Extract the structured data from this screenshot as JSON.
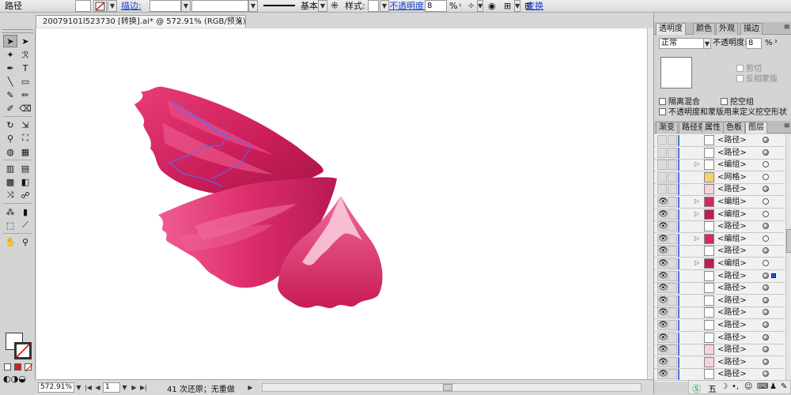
{
  "control_bar": {
    "object_type": "路径",
    "stroke_link": "描边:",
    "stroke_profile": "基本",
    "style_label": "样式:",
    "opacity_link": "不透明度:",
    "opacity_value": "8",
    "opacity_unit": "%",
    "transform_link": "变换"
  },
  "document_tab": {
    "title": "20079101l523730 [转换].ai* @ 572.91% (RGB/预览)",
    "close": "×"
  },
  "tools": {
    "items": [
      {
        "name": "selection-tool",
        "glyph": "➤"
      },
      {
        "name": "direct-selection-tool",
        "glyph": "➤"
      },
      {
        "name": "magic-wand-tool",
        "glyph": "✦"
      },
      {
        "name": "lasso-tool",
        "glyph": "ℛ"
      },
      {
        "name": "pen-tool",
        "glyph": "✒"
      },
      {
        "name": "type-tool",
        "glyph": "T"
      },
      {
        "name": "line-tool",
        "glyph": "╲"
      },
      {
        "name": "rectangle-tool",
        "glyph": "▭"
      },
      {
        "name": "paintbrush-tool",
        "glyph": "✎"
      },
      {
        "name": "pencil-tool",
        "glyph": "✏"
      },
      {
        "name": "blob-brush-tool",
        "glyph": "✐"
      },
      {
        "name": "eraser-tool",
        "glyph": "⌫"
      },
      {
        "name": "rotate-tool",
        "glyph": "↻"
      },
      {
        "name": "scale-tool",
        "glyph": "⇲"
      },
      {
        "name": "width-tool",
        "glyph": "⚲"
      },
      {
        "name": "free-transform-tool",
        "glyph": "⛶"
      },
      {
        "name": "shape-builder-tool",
        "glyph": "◍"
      },
      {
        "name": "live-paint-tool",
        "glyph": "▦"
      },
      {
        "name": "perspective-grid-tool",
        "glyph": "▥"
      },
      {
        "name": "perspective-selection-tool",
        "glyph": "▤"
      },
      {
        "name": "mesh-tool",
        "glyph": "▩"
      },
      {
        "name": "gradient-tool",
        "glyph": "◧"
      },
      {
        "name": "eyedropper-tool",
        "glyph": "⤨"
      },
      {
        "name": "blend-tool",
        "glyph": "☍"
      },
      {
        "name": "symbol-sprayer-tool",
        "glyph": "⁂"
      },
      {
        "name": "column-graph-tool",
        "glyph": "▮"
      },
      {
        "name": "artboard-tool",
        "glyph": "⬚"
      },
      {
        "name": "slice-tool",
        "glyph": "⟋"
      },
      {
        "name": "hand-tool",
        "glyph": "✋"
      },
      {
        "name": "zoom-tool",
        "glyph": "⚲"
      }
    ]
  },
  "status_bar": {
    "zoom": "572.91%",
    "artboard": "1",
    "message": "41 次还原；无重做"
  },
  "transparency_panel": {
    "tabs": [
      "透明度",
      "颜色",
      "外观",
      "描边"
    ],
    "blend_mode": "正常",
    "opacity_label": "不透明度:",
    "opacity_value": "8",
    "opacity_unit": "%",
    "clip_label": "剪切",
    "invert_mask_label": "反相蒙版",
    "isolate_blend_label": "隔离混合",
    "knockout_group_label": "挖空组",
    "opacity_mask_knockout_label": "不透明度和蒙版用来定义挖空形状"
  },
  "layers_panel": {
    "tabs": [
      "渐变",
      "路径查",
      "属性",
      "色板",
      "图层"
    ],
    "rows": [
      {
        "name": "<路径>",
        "twirl": "",
        "thumb": "white",
        "target": "filled",
        "visible": "",
        "sel": false
      },
      {
        "name": "<路径>",
        "twirl": "",
        "thumb": "white",
        "target": "filled",
        "visible": "",
        "sel": false
      },
      {
        "name": "<编组>",
        "twirl": "▷",
        "thumb": "dots",
        "target": "empty",
        "visible": "",
        "sel": false
      },
      {
        "name": "<网格>",
        "twirl": "",
        "thumb": "yellow",
        "target": "empty",
        "visible": "",
        "sel": false
      },
      {
        "name": "<路径>",
        "twirl": "",
        "thumb": "pink",
        "target": "filled",
        "visible": "",
        "sel": false
      },
      {
        "name": "<编组>",
        "twirl": "▷",
        "thumb": "red",
        "target": "empty",
        "visible": "👁",
        "sel": false
      },
      {
        "name": "<编组>",
        "twirl": "▷",
        "thumb": "red2",
        "target": "empty",
        "visible": "👁",
        "sel": false
      },
      {
        "name": "<路径>",
        "twirl": "",
        "thumb": "white",
        "target": "filled",
        "visible": "👁",
        "sel": false
      },
      {
        "name": "<编组>",
        "twirl": "▷",
        "thumb": "red",
        "target": "empty",
        "visible": "👁",
        "sel": false
      },
      {
        "name": "<路径>",
        "twirl": "",
        "thumb": "white",
        "target": "filled",
        "visible": "👁",
        "sel": false
      },
      {
        "name": "<编组>",
        "twirl": "▷",
        "thumb": "red2",
        "target": "empty",
        "visible": "👁",
        "sel": false
      },
      {
        "name": "<路径>",
        "twirl": "",
        "thumb": "white",
        "target": "filled",
        "visible": "👁",
        "sel": true
      },
      {
        "name": "<路径>",
        "twirl": "",
        "thumb": "white",
        "target": "filled",
        "visible": "👁",
        "sel": false
      },
      {
        "name": "<路径>",
        "twirl": "",
        "thumb": "white",
        "target": "filled",
        "visible": "👁",
        "sel": false
      },
      {
        "name": "<路径>",
        "twirl": "",
        "thumb": "white",
        "target": "filled",
        "visible": "👁",
        "sel": false
      },
      {
        "name": "<路径>",
        "twirl": "",
        "thumb": "white",
        "target": "filled",
        "visible": "👁",
        "sel": false
      },
      {
        "name": "<路径>",
        "twirl": "",
        "thumb": "white",
        "target": "filled",
        "visible": "👁",
        "sel": false
      },
      {
        "name": "<路径>",
        "twirl": "",
        "thumb": "pink",
        "target": "filled",
        "visible": "👁",
        "sel": false
      },
      {
        "name": "<路径>",
        "twirl": "",
        "thumb": "pink",
        "target": "filled",
        "visible": "👁",
        "sel": false
      },
      {
        "name": "<路径>",
        "twirl": "",
        "thumb": "white",
        "target": "filled",
        "visible": "👁",
        "sel": false
      }
    ]
  },
  "taskbar": {
    "ime_label": "五"
  },
  "colors": {
    "petal_dark": "#b81c55",
    "petal_mid": "#dc2d6a",
    "petal_light": "#f0609a",
    "selection_blue": "#3a5ee8"
  }
}
